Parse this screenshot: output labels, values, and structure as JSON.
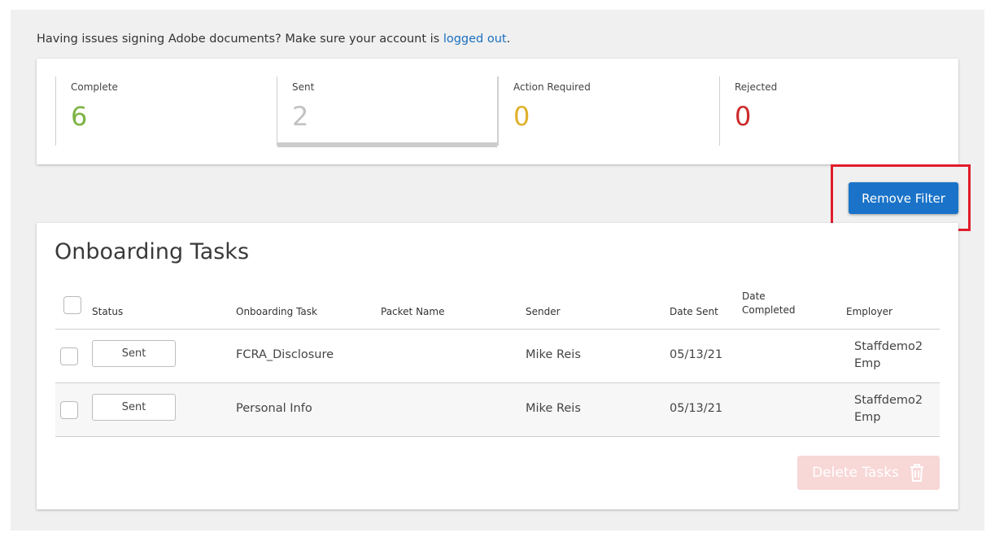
{
  "notice": {
    "text": "Having issues signing Adobe documents? Make sure your account is ",
    "link": "logged out",
    "suffix": "."
  },
  "stats": [
    {
      "label": "Complete",
      "value": "6",
      "color": "#7bb342"
    },
    {
      "label": "Sent",
      "value": "2",
      "color": "#c2c2c2",
      "selected": true
    },
    {
      "label": "Action Required",
      "value": "0",
      "color": "#e0b12c"
    },
    {
      "label": "Rejected",
      "value": "0",
      "color": "#cc2a2a"
    }
  ],
  "filter": {
    "remove_label": "Remove Filter"
  },
  "tasks": {
    "title": "Onboarding Tasks",
    "columns": {
      "status": "Status",
      "task": "Onboarding Task",
      "packet": "Packet Name",
      "sender": "Sender",
      "date_sent": "Date Sent",
      "date_completed_1": "Date",
      "date_completed_2": "Completed",
      "employer": "Employer"
    },
    "rows": [
      {
        "status": "Sent",
        "task": "FCRA_Disclosure",
        "packet": "",
        "sender": "Mike Reis",
        "date_sent": "05/13/21",
        "date_completed": "",
        "employer_1": "Staffdemo2",
        "employer_2": "Emp"
      },
      {
        "status": "Sent",
        "task": "Personal Info",
        "packet": "",
        "sender": "Mike Reis",
        "date_sent": "05/13/21",
        "date_completed": "",
        "employer_1": "Staffdemo2",
        "employer_2": "Emp"
      }
    ],
    "delete_label": "Delete Tasks",
    "delete_icon": "trash-icon"
  }
}
